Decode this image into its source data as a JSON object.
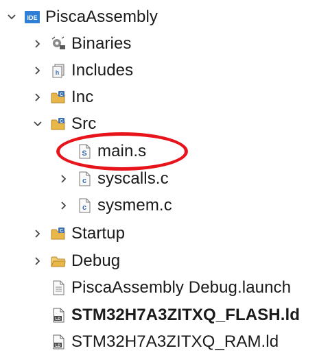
{
  "project": {
    "name": "PiscaAssembly",
    "badge": "IDE",
    "expanded": true,
    "icon": "ide-project-icon"
  },
  "items": [
    {
      "label": "Binaries",
      "icon": "binaries-icon",
      "toggle": "collapsed",
      "bold": false
    },
    {
      "label": "Includes",
      "icon": "includes-icon",
      "toggle": "collapsed",
      "bold": false
    },
    {
      "label": "Inc",
      "icon": "source-folder-icon",
      "toggle": "collapsed",
      "bold": false
    },
    {
      "label": "Src",
      "icon": "source-folder-icon",
      "toggle": "expanded",
      "bold": false
    },
    {
      "label": "main.s",
      "icon": "asm-file-icon",
      "toggle": "none",
      "bold": false,
      "highlighted": true
    },
    {
      "label": "syscalls.c",
      "icon": "c-file-icon",
      "toggle": "collapsed",
      "bold": false
    },
    {
      "label": "sysmem.c",
      "icon": "c-file-icon",
      "toggle": "collapsed",
      "bold": false
    },
    {
      "label": "Startup",
      "icon": "source-folder-icon",
      "toggle": "collapsed",
      "bold": false
    },
    {
      "label": "Debug",
      "icon": "folder-icon",
      "toggle": "collapsed",
      "bold": false
    },
    {
      "label": "PiscaAssembly Debug.launch",
      "icon": "launch-file-icon",
      "toggle": "none",
      "bold": false
    },
    {
      "label": "STM32H7A3ZITXQ_FLASH.ld",
      "icon": "linker-file-icon",
      "toggle": "none",
      "bold": true
    },
    {
      "label": "STM32H7A3ZITXQ_RAM.ld",
      "icon": "linker-file-icon",
      "toggle": "none",
      "bold": false
    }
  ],
  "colors": {
    "highlight_ring": "#e8141c",
    "ide_badge": "#2f7fd6",
    "folder": "#e8b74a",
    "c_file": "#3b6fb0"
  }
}
